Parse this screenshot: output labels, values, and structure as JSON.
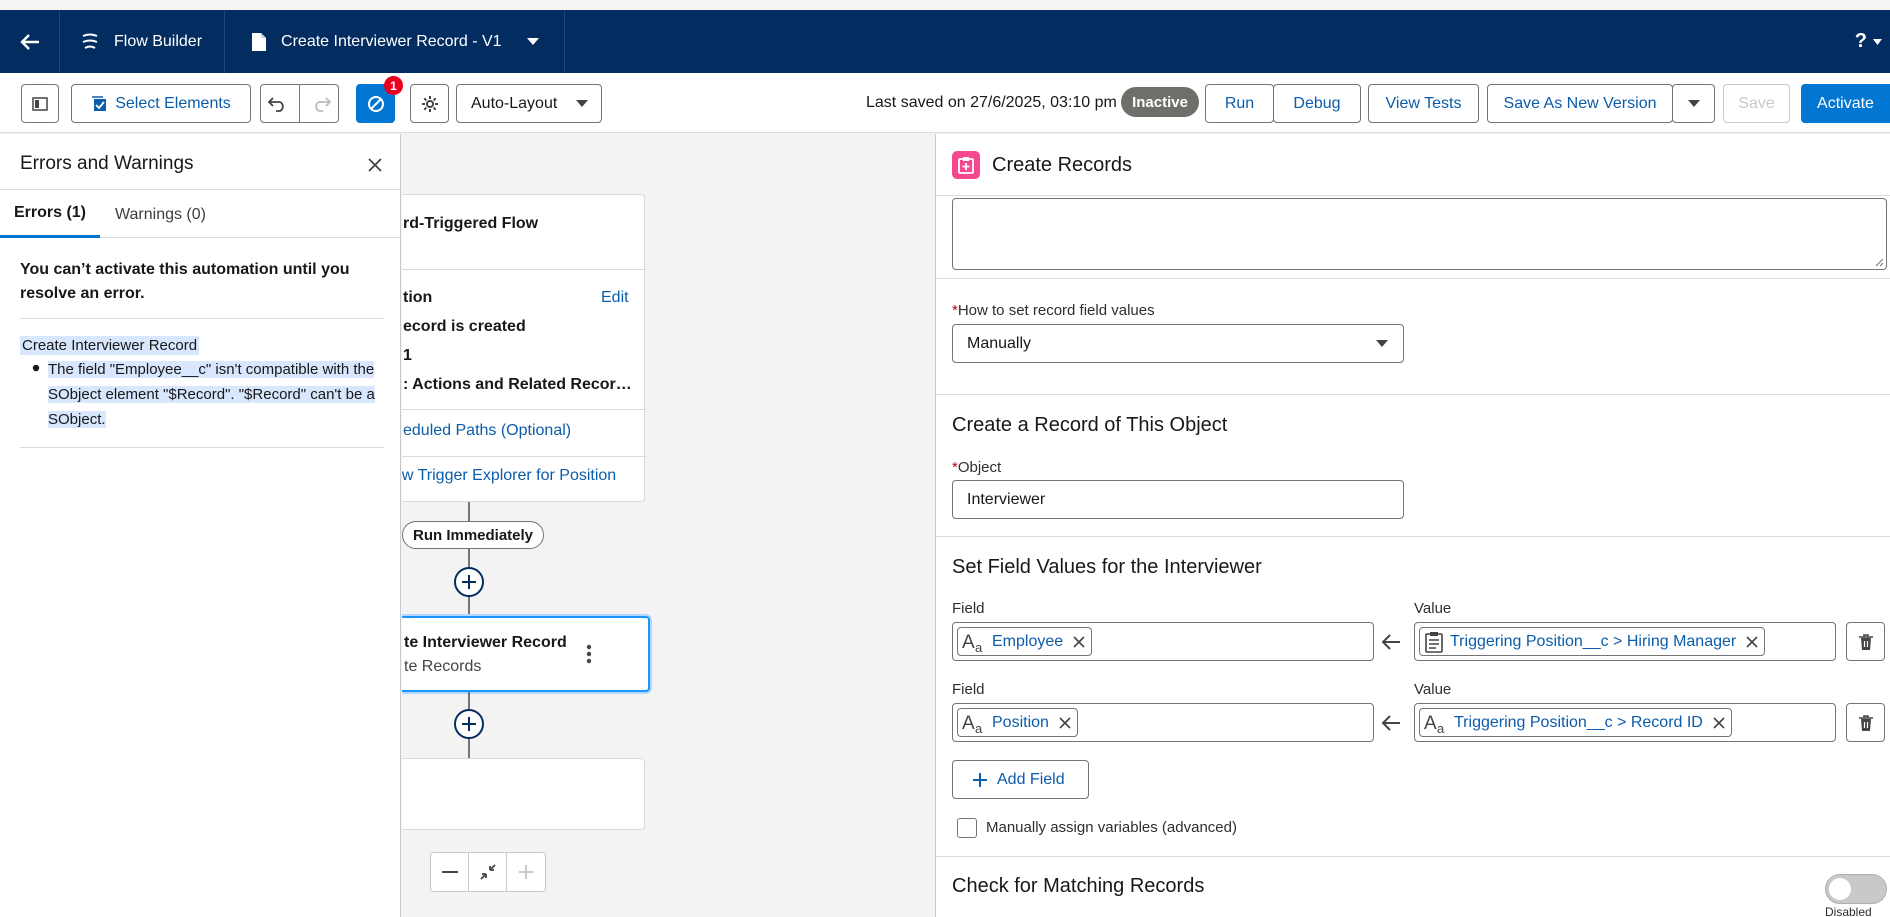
{
  "header": {
    "app_name": "Flow Builder",
    "doc_title": "Create Interviewer Record - V1",
    "help": "?"
  },
  "toolbar": {
    "select_elements": "Select Elements",
    "error_count": "1",
    "layout_select": "Auto-Layout",
    "last_saved": "Last saved on 27/6/2025, 03:10 pm",
    "status": "Inactive",
    "run": "Run",
    "debug": "Debug",
    "view_tests": "View Tests",
    "save_as_new": "Save As New Version",
    "save": "Save",
    "activate": "Activate"
  },
  "errors_panel": {
    "title": "Errors and Warnings",
    "tabs": [
      {
        "label": "Errors (1)"
      },
      {
        "label": "Warnings (0)"
      }
    ],
    "headline": "You can’t activate this automation until you resolve an error.",
    "error_element": "Create Interviewer Record",
    "error_message": "The field \"Employee__c\" isn't compatible with the SObject element \"$Record\". \"$Record\" can't be a SObject."
  },
  "canvas": {
    "start_card_title": "rd-Triggered Flow",
    "condition_label": "tion",
    "edit": "Edit",
    "trigger_line": "ecord is created",
    "line_3": "1",
    "optimize_line": ": Actions and Related Recor…",
    "scheduled_paths": "eduled Paths (Optional)",
    "trigger_explorer": "ow Trigger Explorer for Position",
    "run_immediately": "Run Immediately",
    "element_title": "te Interviewer Record",
    "element_subtitle": "te Records"
  },
  "create_records": {
    "title": "Create Records",
    "how_label": "How to set record field values",
    "how_value": "Manually",
    "section_object": "Create a Record of This Object",
    "object_label": "Object",
    "object_value": "Interviewer",
    "section_fields": "Set Field Values for the Interviewer",
    "rows": [
      {
        "field_label": "Field",
        "field": "Employee",
        "value_label": "Value",
        "value": "Triggering Position__c > Hiring Manager"
      },
      {
        "field_label": "Field",
        "field": "Position",
        "value_label": "Value",
        "value": "Triggering Position__c > Record ID"
      }
    ],
    "add_field": "Add Field",
    "manual_assign": "Manually assign variables (advanced)",
    "section_matching": "Check for Matching Records",
    "toggle_state": "Disabled"
  },
  "colors": {
    "header_bg": "#032d60",
    "brand_blue": "#0176d3",
    "link_blue": "#0b5cab",
    "error_red": "#ea001e",
    "records_icon": "#f5498f"
  }
}
